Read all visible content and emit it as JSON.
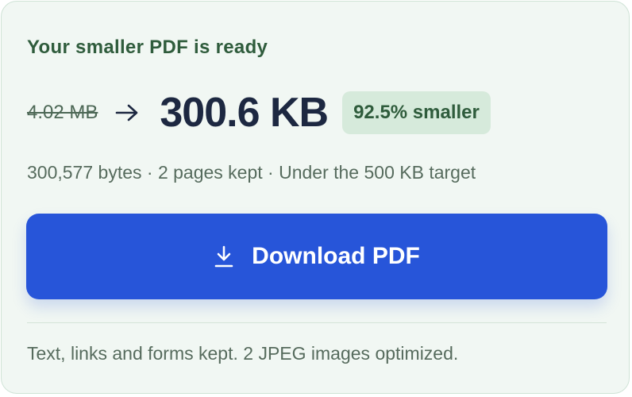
{
  "result": {
    "heading": "Your smaller PDF is ready",
    "original_size": "4.02 MB",
    "new_size": "300.6 KB",
    "reduction_badge": "92.5% smaller",
    "details": "300,577 bytes · 2 pages kept · Under the 500 KB target",
    "download_label": "Download PDF",
    "footnote": "Text, links and forms kept. 2 JPEG images optimized."
  },
  "icons": {
    "arrow": "arrow-right-icon",
    "download": "download-icon"
  },
  "colors": {
    "card_background": "#f1f7f3",
    "card_border": "#cfe3d6",
    "heading": "#2f5c3c",
    "badge_background": "#d6eadb",
    "new_size_text": "#1d2841",
    "button_background": "#2755d9",
    "button_text": "#ffffff"
  }
}
